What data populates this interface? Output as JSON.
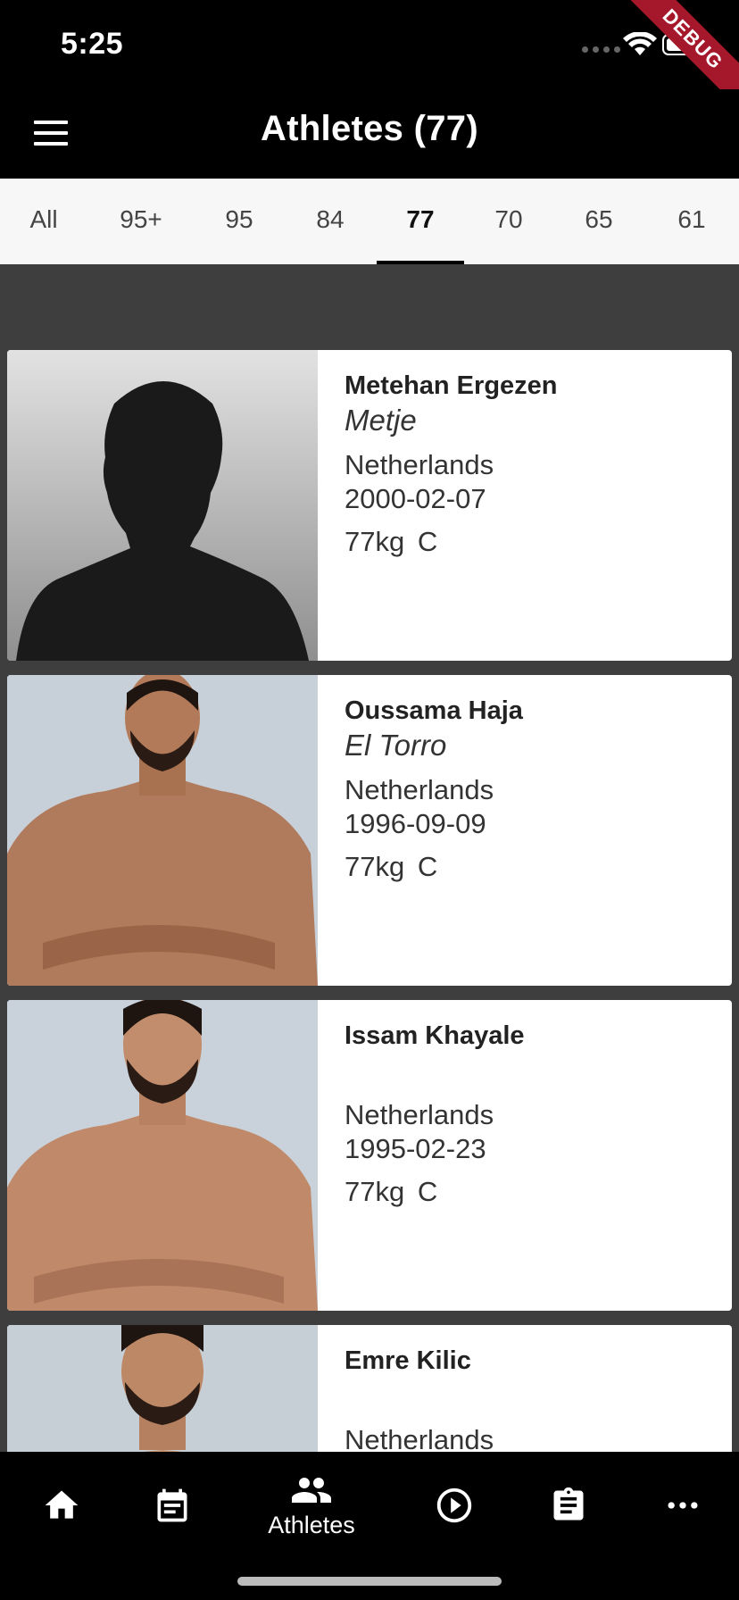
{
  "status_bar": {
    "time": "5:25",
    "debug_label": "DEBUG"
  },
  "app_bar": {
    "title": "Athletes (77)"
  },
  "tabs": [
    {
      "label": "All",
      "active": false
    },
    {
      "label": "95+",
      "active": false
    },
    {
      "label": "95",
      "active": false
    },
    {
      "label": "84",
      "active": false
    },
    {
      "label": "77",
      "active": true
    },
    {
      "label": "70",
      "active": false
    },
    {
      "label": "65",
      "active": false
    },
    {
      "label": "61",
      "active": false
    }
  ],
  "athletes": [
    {
      "name": "Metehan Ergezen",
      "nickname": "Metje",
      "country": "Netherlands",
      "dob": "2000-02-07",
      "weight_class": "77kg  C",
      "photo": "silhouette"
    },
    {
      "name": "Oussama Haja",
      "nickname": "El Torro",
      "country": "Netherlands",
      "dob": "1996-09-09",
      "weight_class": "77kg  C",
      "photo": "photo"
    },
    {
      "name": "Issam Khayale",
      "nickname": "",
      "country": "Netherlands",
      "dob": "1995-02-23",
      "weight_class": "77kg  C",
      "photo": "photo"
    },
    {
      "name": "Emre Kilic",
      "nickname": "",
      "country": "Netherlands",
      "dob": "",
      "weight_class": "",
      "photo": "photo"
    }
  ],
  "bottom_nav": [
    {
      "icon": "home-icon",
      "label": "",
      "active": false
    },
    {
      "icon": "calendar-icon",
      "label": "",
      "active": false
    },
    {
      "icon": "people-icon",
      "label": "Athletes",
      "active": true
    },
    {
      "icon": "play-circle-icon",
      "label": "",
      "active": false
    },
    {
      "icon": "clipboard-icon",
      "label": "",
      "active": false
    },
    {
      "icon": "more-icon",
      "label": "",
      "active": false
    }
  ],
  "colors": {
    "app_bar": "#000000",
    "tab_bar": "#f7f7f7",
    "content_bg": "#3e3e3e",
    "card_bg": "#ffffff",
    "debug_ribbon": "#a5182b"
  }
}
